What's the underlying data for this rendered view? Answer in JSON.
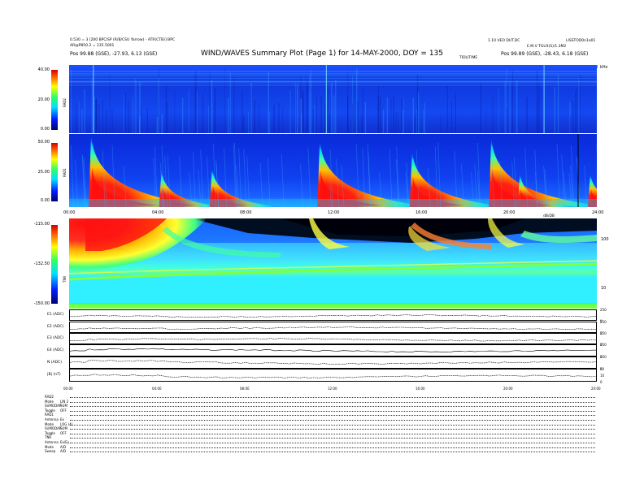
{
  "header": {
    "left_line1": "0.530 = 3 [200 BPC/SP (R/B/CSU Yarrow) - ATR(CTB)] BPC",
    "left_line2": "AR@P850.2 = 135.5001",
    "right_line1": "1.10 VEO DUT.DC",
    "right_line2": "LISSTOD0n1a01",
    "right_line3": "E.M.V TGU3(S)/1.3M2",
    "right_line4": "TIDLITIME",
    "left_pos_label": "Pos",
    "left_pos_value": "99.88 (GSE), -27.93, 6.13 (GSE)",
    "right_pos_label": "Pos",
    "right_pos_value": "99.89 (GSE), -28.43, 6.18 (GSE)",
    "title": "WIND/WAVES Summary Plot (Page 1) for 14-MAY-2000, DOY = 135"
  },
  "rad2": {
    "label": "RAD2",
    "ticks": [
      "40.00",
      "20.00",
      "0.00"
    ],
    "right_top": "kHz",
    "right_zero": "0"
  },
  "rad1": {
    "label": "RAD1",
    "ticks": [
      "50.00",
      "25.00",
      "0.00"
    ],
    "x_ticks": [
      "00:00",
      "04:00",
      "08:00",
      "12:00",
      "16:00",
      "20:00",
      "24:00"
    ]
  },
  "tnr": {
    "label": "TNR",
    "ticks": [
      "-115.00",
      "-132.50",
      "-150.00"
    ],
    "right_label": "dB/DB",
    "right_ticks": [
      "100",
      "10"
    ]
  },
  "line_panels": [
    {
      "label": "E1 (ADC)",
      "rt": [
        "250",
        "0"
      ]
    },
    {
      "label": "E2 (ADC)",
      "rt": [
        "250",
        "0"
      ]
    },
    {
      "label": "E3 (ADC)",
      "rt": [
        "250",
        "0"
      ]
    },
    {
      "label": "E4 (ADC)",
      "rt": [
        "250",
        "0"
      ]
    },
    {
      "label": "N (ADC)",
      "rt": [
        "250",
        "0"
      ]
    },
    {
      "label": "|B| (nT)",
      "rt": [
        "50",
        "10",
        "0"
      ]
    }
  ],
  "bottom_x_ticks": [
    "00:00",
    "04:00",
    "08:00",
    "12:00",
    "16:00",
    "20:00",
    "24:00"
  ],
  "footer": [
    {
      "label": "RAD2",
      "value": ""
    },
    {
      "label": "Mode",
      "value": "LIN 2"
    },
    {
      "label": "SUMODAP",
      "value": "SUM"
    },
    {
      "label": "Toggle",
      "value": "OFF"
    },
    {
      "label": "RAD1",
      "value": ""
    },
    {
      "label": "Antenna",
      "value": "Ex"
    },
    {
      "label": "Mode",
      "value": "LOG (4)"
    },
    {
      "label": "SUMODAP",
      "value": "SUM"
    },
    {
      "label": "Toggle",
      "value": "OFF"
    },
    {
      "label": "TNR",
      "value": ""
    },
    {
      "label": "Antenna",
      "value": "Ex/Ey"
    },
    {
      "label": "Mode",
      "value": "A/D"
    },
    {
      "label": "Sweep",
      "value": "A/D"
    }
  ],
  "chart_data": {
    "type": "heatmap",
    "title": "WIND/WAVES Summary Plot (Page 1) for 14-MAY-2000, DOY = 135",
    "x_axis": {
      "label": "",
      "range": [
        "00:00",
        "24:00"
      ]
    },
    "panels": [
      {
        "name": "RAD2",
        "y_range": [
          0,
          40
        ],
        "colorscale": "jet"
      },
      {
        "name": "RAD1",
        "y_range": [
          0,
          50
        ],
        "colorscale": "jet",
        "bursts_hours": [
          1.0,
          4.2,
          6.5,
          11.4,
          15.6,
          19.2,
          20.5,
          23.7
        ]
      },
      {
        "name": "TNR",
        "y_range": [
          -150,
          -115
        ],
        "colorscale": "jet"
      }
    ],
    "colors": {
      "dark": "#00008b",
      "blue": "#1040ff",
      "cyan": "#00ffff",
      "green": "#40ff40",
      "yellow": "#ffff00",
      "red": "#ff1010"
    }
  }
}
